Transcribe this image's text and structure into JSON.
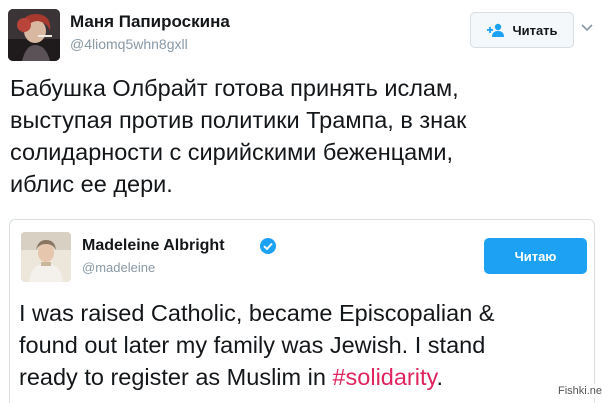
{
  "main_tweet": {
    "display_name": "Маня Папироскина",
    "handle": "@4liomq5whn8gxll",
    "follow_label": "Читать",
    "text": "Бабушка Олбрайт готова принять ислам,\nвыступая против политики Трампа, в знак\nсолидарности с сирийскими беженцами,\nиблис ее дери."
  },
  "quoted_tweet": {
    "display_name": "Madeleine Albright",
    "handle": "@madeleine",
    "following_label": "Читаю",
    "text_part1": "I was raised Catholic, became Episcopalian &\nfound out later my family was Jewish. I stand\nready to register as Muslim in ",
    "hashtag": "#solidarity",
    "text_part2": "."
  },
  "watermark": "Fishki.net",
  "colors": {
    "accent": "#1da1f2",
    "hashtag": "#e0245e",
    "secondary_text": "#8899a6",
    "border": "#d9dfe3"
  },
  "icons": [
    "follow-user-icon",
    "chevron-down-icon",
    "verified-badge-icon"
  ]
}
